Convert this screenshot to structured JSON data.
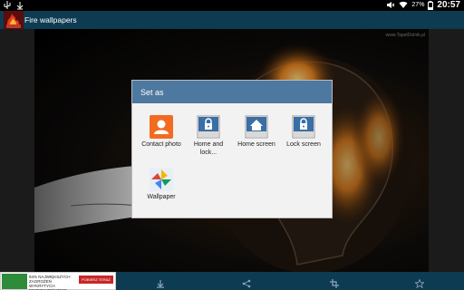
{
  "statusbar": {
    "battery_pct": "27%",
    "time": "20:57"
  },
  "actionbar": {
    "title": "Fire wallpapers"
  },
  "wallpaper": {
    "watermark": "www.TapetDolnik.pl"
  },
  "dialog": {
    "title": "Set as",
    "options": [
      {
        "label": "Contact photo",
        "icon": "contact-icon"
      },
      {
        "label": "Home and lock...",
        "icon": "home-lock-icon"
      },
      {
        "label": "Home screen",
        "icon": "home-icon"
      },
      {
        "label": "Lock screen",
        "icon": "lock-icon"
      },
      {
        "label": "Wallpaper",
        "icon": "pinwheel-icon"
      }
    ]
  },
  "ad": {
    "text": "94% NAJWIĘKSZYCH ZAGROŻEŃ WYKRYTYCH BEZPIECZEŃSTWO",
    "button": "POBIERZ TERAZ"
  },
  "colors": {
    "bar": "#0d3b52",
    "dialog_header": "#4d78a0"
  }
}
